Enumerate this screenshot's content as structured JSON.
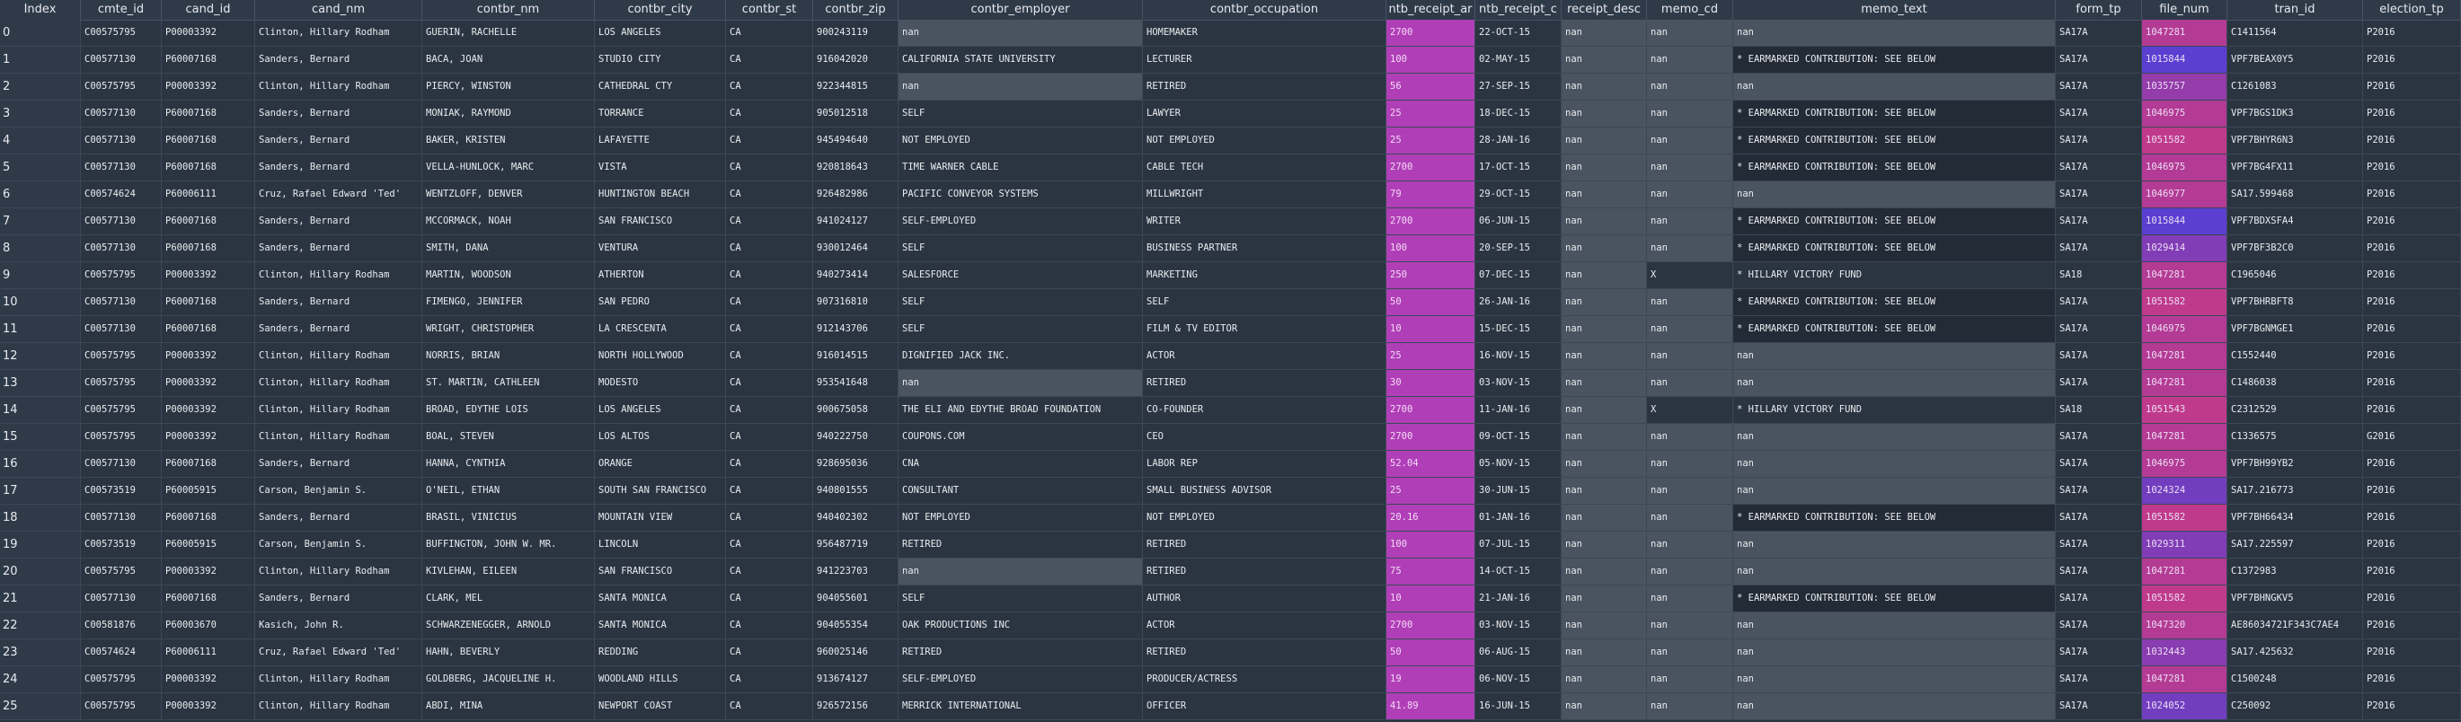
{
  "colors": {
    "header_bg": "#2f3a49",
    "row_bg": "#2b3542",
    "nan_cell_bg": "#4a5360",
    "memo_earmark_bg": "#232b36",
    "amount_purple": "#b03fb7",
    "file_num_scale": [
      "#5a3fd0",
      "#c03a8c"
    ]
  },
  "columns": [
    "Index",
    "cmte_id",
    "cand_id",
    "cand_nm",
    "contbr_nm",
    "contbr_city",
    "contbr_st",
    "contbr_zip",
    "contbr_employer",
    "contbr_occupation",
    "contb_receipt_amt",
    "contb_receipt_dt",
    "receipt_desc",
    "memo_cd",
    "memo_text",
    "form_tp",
    "file_num",
    "tran_id",
    "election_tp"
  ],
  "header_display": [
    "Index",
    "cmte_id",
    "cand_id",
    "cand_nm",
    "contbr_nm",
    "contbr_city",
    "contbr_st",
    "contbr_zip",
    "contbr_employer",
    "contbr_occupation",
    "ntb_receipt_ar",
    "ntb_receipt_c",
    "receipt_desc",
    "memo_cd",
    "memo_text",
    "form_tp",
    "file_num",
    "tran_id",
    "election_tp"
  ],
  "rows": [
    [
      "0",
      "C00575795",
      "P00003392",
      "Clinton, Hillary Rodham",
      "GUERIN, RACHELLE",
      "LOS ANGELES",
      "CA",
      "900243119",
      "nan",
      "HOMEMAKER",
      "2700",
      "22-OCT-15",
      "nan",
      "nan",
      "nan",
      "SA17A",
      "1047281",
      "C1411564",
      "P2016"
    ],
    [
      "1",
      "C00577130",
      "P60007168",
      "Sanders, Bernard",
      "BACA, JOAN",
      "STUDIO CITY",
      "CA",
      "916042020",
      "CALIFORNIA STATE UNIVERSITY",
      "LECTURER",
      "100",
      "02-MAY-15",
      "nan",
      "nan",
      "* EARMARKED CONTRIBUTION: SEE BELOW",
      "SA17A",
      "1015844",
      "VPF7BEAX0Y5",
      "P2016"
    ],
    [
      "2",
      "C00575795",
      "P00003392",
      "Clinton, Hillary Rodham",
      "PIERCY, WINSTON",
      "CATHEDRAL CTY",
      "CA",
      "922344815",
      "nan",
      "RETIRED",
      "56",
      "27-SEP-15",
      "nan",
      "nan",
      "nan",
      "SA17A",
      "1035757",
      "C1261083",
      "P2016"
    ],
    [
      "3",
      "C00577130",
      "P60007168",
      "Sanders, Bernard",
      "MONIAK, RAYMOND",
      "TORRANCE",
      "CA",
      "905012518",
      "SELF",
      "LAWYER",
      "25",
      "18-DEC-15",
      "nan",
      "nan",
      "* EARMARKED CONTRIBUTION: SEE BELOW",
      "SA17A",
      "1046975",
      "VPF7BGS1DK3",
      "P2016"
    ],
    [
      "4",
      "C00577130",
      "P60007168",
      "Sanders, Bernard",
      "BAKER, KRISTEN",
      "LAFAYETTE",
      "CA",
      "945494640",
      "NOT EMPLOYED",
      "NOT EMPLOYED",
      "25",
      "28-JAN-16",
      "nan",
      "nan",
      "* EARMARKED CONTRIBUTION: SEE BELOW",
      "SA17A",
      "1051582",
      "VPF7BHYR6N3",
      "P2016"
    ],
    [
      "5",
      "C00577130",
      "P60007168",
      "Sanders, Bernard",
      "VELLA-HUNLOCK, MARC",
      "VISTA",
      "CA",
      "920818643",
      "TIME WARNER CABLE",
      "CABLE TECH",
      "2700",
      "17-OCT-15",
      "nan",
      "nan",
      "* EARMARKED CONTRIBUTION: SEE BELOW",
      "SA17A",
      "1046975",
      "VPF7BG4FX11",
      "P2016"
    ],
    [
      "6",
      "C00574624",
      "P60006111",
      "Cruz, Rafael Edward 'Ted'",
      "WENTZLOFF, DENVER",
      "HUNTINGTON BEACH",
      "CA",
      "926482986",
      "PACIFIC CONVEYOR SYSTEMS",
      "MILLWRIGHT",
      "79",
      "29-OCT-15",
      "nan",
      "nan",
      "nan",
      "SA17A",
      "1046977",
      "SA17.599468",
      "P2016"
    ],
    [
      "7",
      "C00577130",
      "P60007168",
      "Sanders, Bernard",
      "MCCORMACK, NOAH",
      "SAN FRANCISCO",
      "CA",
      "941024127",
      "SELF-EMPLOYED",
      "WRITER",
      "2700",
      "06-JUN-15",
      "nan",
      "nan",
      "* EARMARKED CONTRIBUTION: SEE BELOW",
      "SA17A",
      "1015844",
      "VPF7BDXSFA4",
      "P2016"
    ],
    [
      "8",
      "C00577130",
      "P60007168",
      "Sanders, Bernard",
      "SMITH, DANA",
      "VENTURA",
      "CA",
      "930012464",
      "SELF",
      "BUSINESS PARTNER",
      "100",
      "20-SEP-15",
      "nan",
      "nan",
      "* EARMARKED CONTRIBUTION: SEE BELOW",
      "SA17A",
      "1029414",
      "VPF7BF3B2C0",
      "P2016"
    ],
    [
      "9",
      "C00575795",
      "P00003392",
      "Clinton, Hillary Rodham",
      "MARTIN, WOODSON",
      "ATHERTON",
      "CA",
      "940273414",
      "SALESFORCE",
      "MARKETING",
      "250",
      "07-DEC-15",
      "nan",
      "X",
      "* HILLARY VICTORY FUND",
      "SA18",
      "1047281",
      "C1965046",
      "P2016"
    ],
    [
      "10",
      "C00577130",
      "P60007168",
      "Sanders, Bernard",
      "FIMENGO, JENNIFER",
      "SAN PEDRO",
      "CA",
      "907316810",
      "SELF",
      "SELF",
      "50",
      "26-JAN-16",
      "nan",
      "nan",
      "* EARMARKED CONTRIBUTION: SEE BELOW",
      "SA17A",
      "1051582",
      "VPF7BHRBFT8",
      "P2016"
    ],
    [
      "11",
      "C00577130",
      "P60007168",
      "Sanders, Bernard",
      "WRIGHT, CHRISTOPHER",
      "LA CRESCENTA",
      "CA",
      "912143706",
      "SELF",
      "FILM & TV EDITOR",
      "10",
      "15-DEC-15",
      "nan",
      "nan",
      "* EARMARKED CONTRIBUTION: SEE BELOW",
      "SA17A",
      "1046975",
      "VPF7BGNMGE1",
      "P2016"
    ],
    [
      "12",
      "C00575795",
      "P00003392",
      "Clinton, Hillary Rodham",
      "NORRIS, BRIAN",
      "NORTH HOLLYWOOD",
      "CA",
      "916014515",
      "DIGNIFIED JACK INC.",
      "ACTOR",
      "25",
      "16-NOV-15",
      "nan",
      "nan",
      "nan",
      "SA17A",
      "1047281",
      "C1552440",
      "P2016"
    ],
    [
      "13",
      "C00575795",
      "P00003392",
      "Clinton, Hillary Rodham",
      "ST. MARTIN, CATHLEEN",
      "MODESTO",
      "CA",
      "953541648",
      "nan",
      "RETIRED",
      "30",
      "03-NOV-15",
      "nan",
      "nan",
      "nan",
      "SA17A",
      "1047281",
      "C1486038",
      "P2016"
    ],
    [
      "14",
      "C00575795",
      "P00003392",
      "Clinton, Hillary Rodham",
      "BROAD, EDYTHE LOIS",
      "LOS ANGELES",
      "CA",
      "900675058",
      "THE ELI AND EDYTHE BROAD FOUNDATION",
      "CO-FOUNDER",
      "2700",
      "11-JAN-16",
      "nan",
      "X",
      "* HILLARY VICTORY FUND",
      "SA18",
      "1051543",
      "C2312529",
      "P2016"
    ],
    [
      "15",
      "C00575795",
      "P00003392",
      "Clinton, Hillary Rodham",
      "BOAL, STEVEN",
      "LOS ALTOS",
      "CA",
      "940222750",
      "COUPONS.COM",
      "CEO",
      "2700",
      "09-OCT-15",
      "nan",
      "nan",
      "nan",
      "SA17A",
      "1047281",
      "C1336575",
      "G2016"
    ],
    [
      "16",
      "C00577130",
      "P60007168",
      "Sanders, Bernard",
      "HANNA, CYNTHIA",
      "ORANGE",
      "CA",
      "928695036",
      "CNA",
      "LABOR REP",
      "52.04",
      "05-NOV-15",
      "nan",
      "nan",
      "nan",
      "SA17A",
      "1046975",
      "VPF7BH99YB2",
      "P2016"
    ],
    [
      "17",
      "C00573519",
      "P60005915",
      "Carson, Benjamin S.",
      "O'NEIL, ETHAN",
      "SOUTH SAN FRANCISCO",
      "CA",
      "940801555",
      "CONSULTANT",
      "SMALL BUSINESS ADVISOR",
      "25",
      "30-JUN-15",
      "nan",
      "nan",
      "nan",
      "SA17A",
      "1024324",
      "SA17.216773",
      "P2016"
    ],
    [
      "18",
      "C00577130",
      "P60007168",
      "Sanders, Bernard",
      "BRASIL, VINICIUS",
      "MOUNTAIN VIEW",
      "CA",
      "940402302",
      "NOT EMPLOYED",
      "NOT EMPLOYED",
      "20.16",
      "01-JAN-16",
      "nan",
      "nan",
      "* EARMARKED CONTRIBUTION: SEE BELOW",
      "SA17A",
      "1051582",
      "VPF7BH66434",
      "P2016"
    ],
    [
      "19",
      "C00573519",
      "P60005915",
      "Carson, Benjamin S.",
      "BUFFINGTON, JOHN W. MR.",
      "LINCOLN",
      "CA",
      "956487719",
      "RETIRED",
      "RETIRED",
      "100",
      "07-JUL-15",
      "nan",
      "nan",
      "nan",
      "SA17A",
      "1029311",
      "SA17.225597",
      "P2016"
    ],
    [
      "20",
      "C00575795",
      "P00003392",
      "Clinton, Hillary Rodham",
      "KIVLEHAN, EILEEN",
      "SAN FRANCISCO",
      "CA",
      "941223703",
      "nan",
      "RETIRED",
      "75",
      "14-OCT-15",
      "nan",
      "nan",
      "nan",
      "SA17A",
      "1047281",
      "C1372983",
      "P2016"
    ],
    [
      "21",
      "C00577130",
      "P60007168",
      "Sanders, Bernard",
      "CLARK, MEL",
      "SANTA MONICA",
      "CA",
      "904055601",
      "SELF",
      "AUTHOR",
      "10",
      "21-JAN-16",
      "nan",
      "nan",
      "* EARMARKED CONTRIBUTION: SEE BELOW",
      "SA17A",
      "1051582",
      "VPF7BHNGKV5",
      "P2016"
    ],
    [
      "22",
      "C00581876",
      "P60003670",
      "Kasich, John R.",
      "SCHWARZENEGGER, ARNOLD",
      "SANTA MONICA",
      "CA",
      "904055354",
      "OAK PRODUCTIONS INC",
      "ACTOR",
      "2700",
      "03-NOV-15",
      "nan",
      "nan",
      "nan",
      "SA17A",
      "1047320",
      "AE86034721F343C7AE4",
      "P2016"
    ],
    [
      "23",
      "C00574624",
      "P60006111",
      "Cruz, Rafael Edward 'Ted'",
      "HAHN, BEVERLY",
      "REDDING",
      "CA",
      "960025146",
      "RETIRED",
      "RETIRED",
      "50",
      "06-AUG-15",
      "nan",
      "nan",
      "nan",
      "SA17A",
      "1032443",
      "SA17.425632",
      "P2016"
    ],
    [
      "24",
      "C00575795",
      "P00003392",
      "Clinton, Hillary Rodham",
      "GOLDBERG, JACQUELINE H.",
      "WOODLAND HILLS",
      "CA",
      "913674127",
      "SELF-EMPLOYED",
      "PRODUCER/ACTRESS",
      "19",
      "06-NOV-15",
      "nan",
      "nan",
      "nan",
      "SA17A",
      "1047281",
      "C1500248",
      "P2016"
    ],
    [
      "25",
      "C00575795",
      "P00003392",
      "Clinton, Hillary Rodham",
      "ABDI, MINA",
      "NEWPORT COAST",
      "CA",
      "926572156",
      "MERRICK INTERNATIONAL",
      "OFFICER",
      "41.89",
      "16-JUN-15",
      "nan",
      "nan",
      "nan",
      "SA17A",
      "1024052",
      "C250092",
      "P2016"
    ]
  ]
}
